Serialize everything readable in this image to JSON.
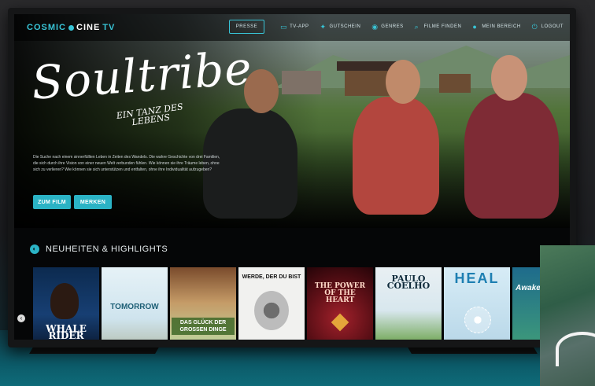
{
  "header": {
    "logo": {
      "part1": "COSMIC",
      "part2": "CINE",
      "part3": "TV"
    },
    "press_button": "PRESSE",
    "nav": [
      {
        "label": "TV-APP",
        "icon": "tv-icon"
      },
      {
        "label": "GUTSCHEIN",
        "icon": "voucher-icon"
      },
      {
        "label": "GENRES",
        "icon": "genres-icon"
      },
      {
        "label": "FILME FINDEN",
        "icon": "search-icon"
      },
      {
        "label": "MEIN BEREICH",
        "icon": "user-icon"
      },
      {
        "label": "LOGOUT",
        "icon": "logout-icon"
      }
    ]
  },
  "hero": {
    "title": "Soultribe",
    "subtitle": "EIN TANZ DES LEBENS",
    "description": "Die Suche nach einem sinnerfüllten Leben in Zeiten des Wandels. Die wahre Geschichte von drei Familien, die sich durch ihre Vision von einer neuen Welt verbunden fühlen. Wie können sie ihre Träume leben, ohne sich zu verlieren? Wie können sie sich unterstützen und entfalten, ohne ihre Individualität aufzugeben?",
    "buttons": {
      "watch": "ZUM FILM",
      "bookmark": "MERKEN"
    }
  },
  "section": {
    "title": "NEUHEITEN & HIGHLIGHTS"
  },
  "posters": [
    {
      "title": "WHALE RIDER"
    },
    {
      "title": "TOMORROW"
    },
    {
      "title": "DAS GLÜCK DER GROSSEN DINGE"
    },
    {
      "title": "WERDE, DER DU BIST"
    },
    {
      "title": "THE POWER OF THE HEART"
    },
    {
      "title": "PAULO COELHO"
    },
    {
      "title": "HEAL"
    },
    {
      "title": "Awake"
    }
  ],
  "colors": {
    "accent": "#2bb3c5",
    "background": "#050607"
  }
}
